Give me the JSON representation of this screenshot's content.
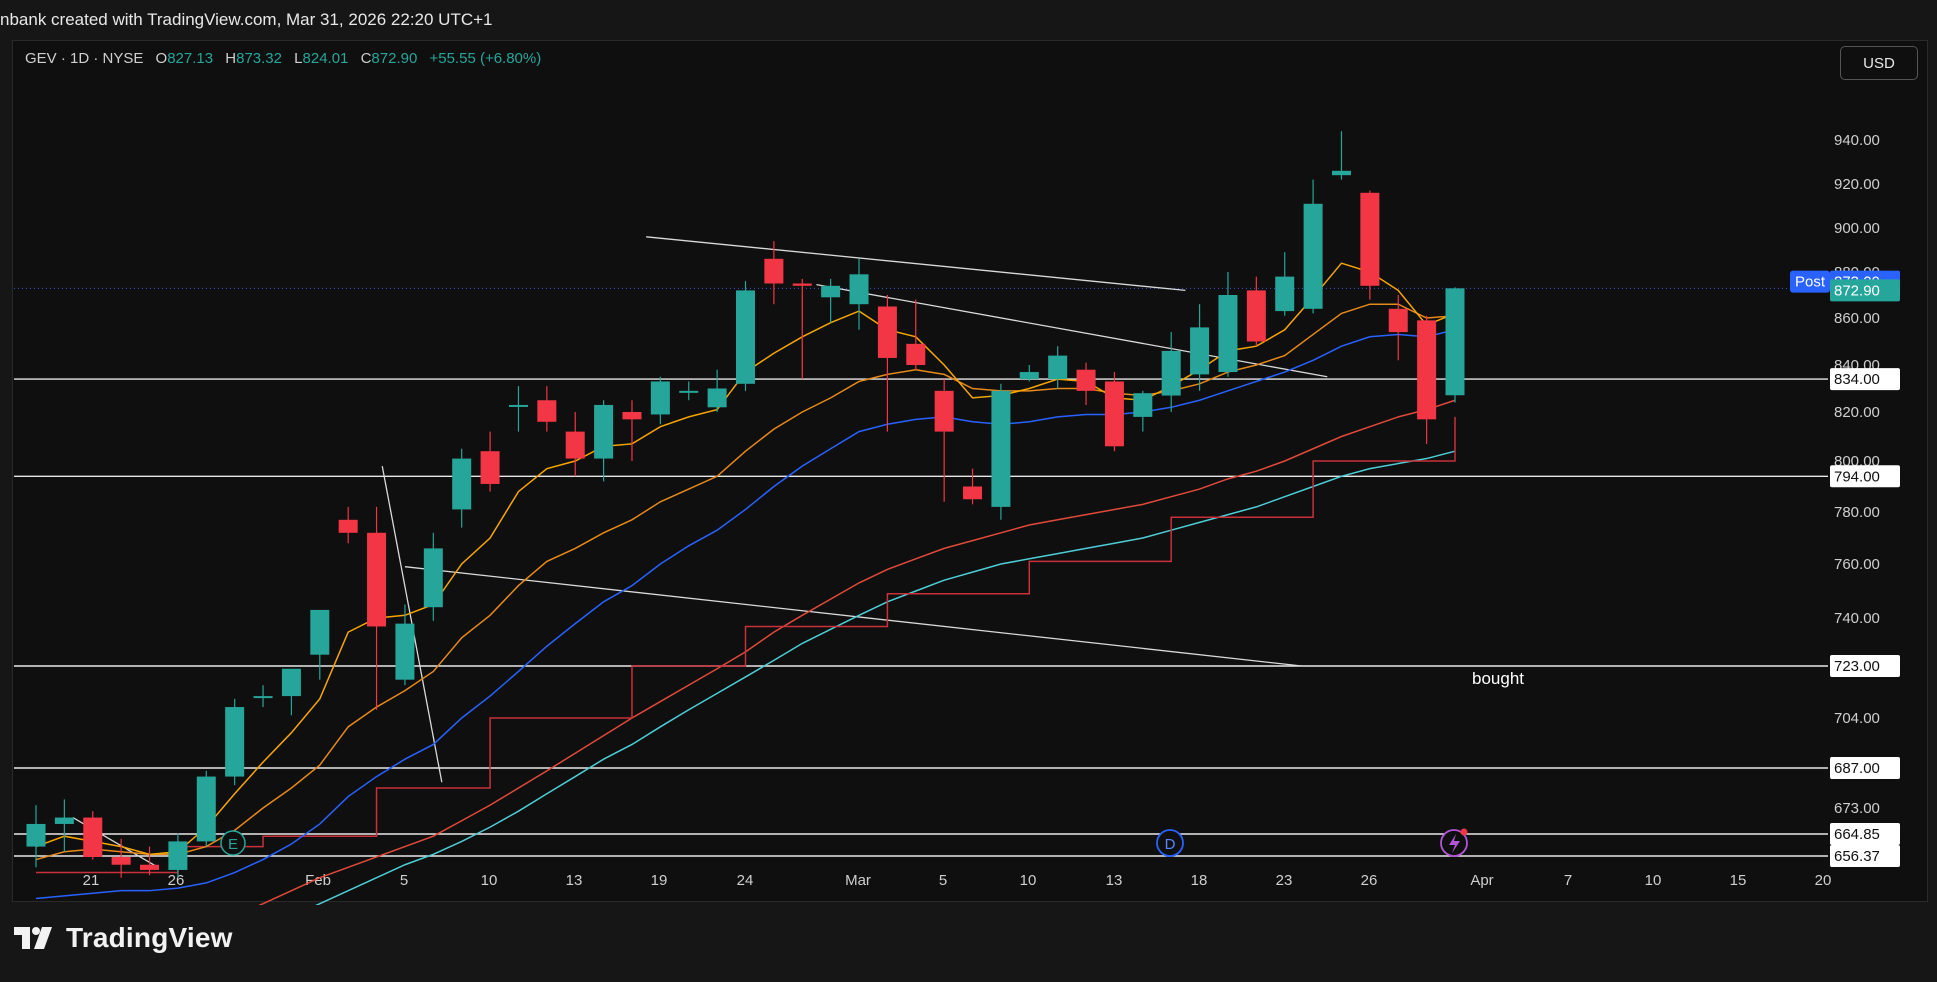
{
  "credit": "nbank created with TradingView.com, Mar 31, 2026 22:20 UTC+1",
  "legend": {
    "symbol": "GEV · 1D · NYSE",
    "o_label": "O",
    "open": "827.13",
    "h_label": "H",
    "high": "873.32",
    "l_label": "L",
    "low": "824.01",
    "c_label": "C",
    "close": "872.90",
    "change": "+55.55 (+6.80%)"
  },
  "currency": "USD",
  "brand": "TradingView",
  "colors": {
    "up": "#26a69a",
    "down": "#f23645",
    "ema_fast": "#f7a600",
    "ema_slow": "#e5891a",
    "sma_blue": "#2962ff",
    "line_red": "#e04a3b",
    "line_teal": "#4ecdd6",
    "kijun_red": "#c8303a",
    "post_badge": "#2962ff"
  },
  "chart_data": {
    "type": "candlestick",
    "y_ticks": [
      "940.00",
      "920.00",
      "900.00",
      "880.00",
      "860.00",
      "840.00",
      "820.00",
      "800.00",
      "780.00",
      "760.00",
      "740.00",
      "723.00",
      "704.00",
      "687.00",
      "673.00",
      "664.85",
      "656.37"
    ],
    "x_ticks": [
      "21",
      "26",
      "Feb",
      "5",
      "10",
      "13",
      "19",
      "24",
      "Mar",
      "5",
      "10",
      "13",
      "18",
      "23",
      "26",
      "Apr",
      "7",
      "10",
      "15",
      "20"
    ],
    "candles": [
      {
        "date": "Jan 16",
        "o": 660,
        "h": 674,
        "l": 652,
        "c": 668
      },
      {
        "date": "Jan 20",
        "o": 668,
        "h": 676,
        "l": 658,
        "c": 670
      },
      {
        "date": "Jan 21",
        "o": 670,
        "h": 672,
        "l": 655,
        "c": 656
      },
      {
        "date": "Jan 22",
        "o": 656,
        "h": 663,
        "l": 648,
        "c": 653
      },
      {
        "date": "Jan 23",
        "o": 653,
        "h": 660,
        "l": 649,
        "c": 651
      },
      {
        "date": "Jan 26",
        "o": 651,
        "h": 665,
        "l": 648,
        "c": 662
      },
      {
        "date": "Jan 27",
        "o": 662,
        "h": 686,
        "l": 660,
        "c": 684
      },
      {
        "date": "Jan 28",
        "o": 684,
        "h": 711,
        "l": 681,
        "c": 708
      },
      {
        "date": "Jan 29",
        "o": 712,
        "h": 716,
        "l": 708,
        "c": 712
      },
      {
        "date": "Jan 30",
        "o": 712,
        "h": 720,
        "l": 705,
        "c": 722
      },
      {
        "date": "Feb 2",
        "o": 727,
        "h": 737,
        "l": 718,
        "c": 743
      },
      {
        "date": "Feb 3",
        "o": 777,
        "h": 782,
        "l": 768,
        "c": 772
      },
      {
        "date": "Feb 4",
        "o": 772,
        "h": 782,
        "l": 707,
        "c": 737
      },
      {
        "date": "Feb 5",
        "o": 718,
        "h": 745,
        "l": 716,
        "c": 738
      },
      {
        "date": "Feb 6",
        "o": 744,
        "h": 772,
        "l": 739,
        "c": 766
      },
      {
        "date": "Feb 9",
        "o": 781,
        "h": 805,
        "l": 774,
        "c": 801
      },
      {
        "date": "Feb 10",
        "o": 804,
        "h": 812,
        "l": 788,
        "c": 791
      },
      {
        "date": "Feb 11",
        "o": 823,
        "h": 831,
        "l": 812,
        "c": 823
      },
      {
        "date": "Feb 12",
        "o": 825,
        "h": 831,
        "l": 812,
        "c": 816
      },
      {
        "date": "Feb 13",
        "o": 812,
        "h": 820,
        "l": 794,
        "c": 801
      },
      {
        "date": "Feb 17",
        "o": 801,
        "h": 825,
        "l": 792,
        "c": 823
      },
      {
        "date": "Feb 18",
        "o": 820,
        "h": 825,
        "l": 800,
        "c": 817
      },
      {
        "date": "Feb 19",
        "o": 819,
        "h": 835,
        "l": 815,
        "c": 833
      },
      {
        "date": "Feb 20",
        "o": 829,
        "h": 833,
        "l": 825,
        "c": 829
      },
      {
        "date": "Feb 23",
        "o": 822,
        "h": 838,
        "l": 820,
        "c": 830
      },
      {
        "date": "Feb 24",
        "o": 832,
        "h": 876,
        "l": 829,
        "c": 872
      },
      {
        "date": "Feb 25",
        "o": 886,
        "h": 894,
        "l": 866,
        "c": 875
      },
      {
        "date": "Feb 26",
        "o": 875,
        "h": 877,
        "l": 834,
        "c": 874
      },
      {
        "date": "Feb 27",
        "o": 869,
        "h": 877,
        "l": 858,
        "c": 874
      },
      {
        "date": "Mar 2",
        "o": 866,
        "h": 886,
        "l": 855,
        "c": 879
      },
      {
        "date": "Mar 3",
        "o": 865,
        "h": 870,
        "l": 812,
        "c": 843
      },
      {
        "date": "Mar 4",
        "o": 849,
        "h": 868,
        "l": 838,
        "c": 840
      },
      {
        "date": "Mar 5",
        "o": 829,
        "h": 834,
        "l": 784,
        "c": 812
      },
      {
        "date": "Mar 6",
        "o": 790,
        "h": 797,
        "l": 783,
        "c": 785
      },
      {
        "date": "Mar 9",
        "o": 782,
        "h": 832,
        "l": 777,
        "c": 829
      },
      {
        "date": "Mar 10",
        "o": 834,
        "h": 840,
        "l": 833,
        "c": 837
      },
      {
        "date": "Mar 11",
        "o": 834,
        "h": 848,
        "l": 830,
        "c": 844
      },
      {
        "date": "Mar 12",
        "o": 838,
        "h": 841,
        "l": 823,
        "c": 829
      },
      {
        "date": "Mar 13",
        "o": 833,
        "h": 837,
        "l": 804,
        "c": 806
      },
      {
        "date": "Mar 16",
        "o": 818,
        "h": 829,
        "l": 812,
        "c": 828
      },
      {
        "date": "Mar 17",
        "o": 827,
        "h": 854,
        "l": 820,
        "c": 846
      },
      {
        "date": "Mar 18",
        "o": 836,
        "h": 866,
        "l": 829,
        "c": 856
      },
      {
        "date": "Mar 19",
        "o": 837,
        "h": 880,
        "l": 835,
        "c": 870
      },
      {
        "date": "Mar 20",
        "o": 872,
        "h": 878,
        "l": 848,
        "c": 850
      },
      {
        "date": "Mar 23",
        "o": 863,
        "h": 889,
        "l": 861,
        "c": 878
      },
      {
        "date": "Mar 24",
        "o": 864,
        "h": 922,
        "l": 862,
        "c": 911
      },
      {
        "date": "Mar 25",
        "o": 924,
        "h": 944,
        "l": 922,
        "c": 926
      },
      {
        "date": "Mar 26",
        "o": 916,
        "h": 917,
        "l": 868,
        "c": 874
      },
      {
        "date": "Mar 27",
        "o": 864,
        "h": 870,
        "l": 842,
        "c": 854
      },
      {
        "date": "Mar 30",
        "o": 859,
        "h": 861,
        "l": 807,
        "c": 817
      },
      {
        "date": "Mar 31",
        "o": 827.13,
        "h": 873.32,
        "l": 824.01,
        "c": 872.9
      }
    ],
    "ema_fast": [
      660,
      664,
      662,
      660,
      657,
      658,
      667,
      678,
      689,
      699,
      711,
      735,
      740,
      741,
      745,
      760,
      770,
      788,
      797,
      800,
      806,
      807,
      814,
      818,
      821,
      837,
      845,
      852,
      858,
      863,
      855,
      852,
      840,
      826,
      827,
      830,
      834,
      833,
      826,
      825,
      831,
      838,
      846,
      848,
      855,
      869,
      884,
      880,
      872,
      857,
      862
    ],
    "ema_slow": [
      655,
      658,
      659,
      658,
      657,
      657,
      660,
      666,
      673,
      680,
      688,
      701,
      708,
      714,
      721,
      733,
      741,
      752,
      761,
      766,
      772,
      777,
      784,
      789,
      794,
      804,
      813,
      820,
      826,
      833,
      836,
      838,
      836,
      830,
      829,
      829,
      830,
      830,
      828,
      827,
      829,
      832,
      837,
      840,
      844,
      853,
      862,
      866,
      866,
      860,
      861
    ],
    "sma_blue": [
      640,
      641,
      642,
      643,
      643,
      644,
      646,
      650,
      655,
      661,
      668,
      677,
      684,
      690,
      695,
      704,
      712,
      721,
      730,
      738,
      746,
      752,
      760,
      767,
      773,
      781,
      790,
      798,
      805,
      812,
      815,
      817,
      818,
      816,
      815,
      816,
      818,
      819,
      819,
      820,
      822,
      825,
      829,
      833,
      837,
      842,
      848,
      852,
      853,
      852,
      855
    ],
    "line_red": [
      610,
      613,
      616,
      619,
      622,
      625,
      629,
      633,
      638,
      643,
      648,
      652,
      656,
      660,
      664,
      669,
      674,
      680,
      686,
      692,
      698,
      704,
      710,
      716,
      722,
      728,
      735,
      741,
      747,
      753,
      758,
      762,
      766,
      769,
      772,
      775,
      777,
      779,
      781,
      783,
      786,
      789,
      793,
      796,
      800,
      805,
      810,
      814,
      818,
      821,
      825
    ],
    "line_teal": [
      600,
      603,
      606,
      609,
      612,
      615,
      619,
      623,
      628,
      633,
      638,
      643,
      648,
      653,
      657,
      662,
      667,
      672,
      678,
      684,
      690,
      695,
      701,
      707,
      713,
      719,
      725,
      731,
      736,
      741,
      746,
      750,
      754,
      757,
      760,
      762,
      764,
      766,
      768,
      770,
      773,
      776,
      779,
      782,
      786,
      790,
      794,
      797,
      799,
      801,
      804
    ],
    "kijun_red": [
      650,
      650,
      650,
      650,
      650,
      660,
      660,
      660,
      664,
      664,
      664,
      664,
      680,
      680,
      680,
      680,
      704,
      704,
      704,
      704,
      704,
      723,
      723,
      723,
      723,
      737,
      737,
      737,
      737,
      737,
      749,
      749,
      749,
      749,
      749,
      761,
      761,
      761,
      761,
      761,
      778,
      778,
      778,
      778,
      778,
      800,
      800,
      800,
      800,
      800,
      818
    ],
    "horizontal_levels": [
      {
        "value": 834.0,
        "label": "834.00"
      },
      {
        "value": 794.0,
        "label": "794.00"
      },
      {
        "value": 723.0,
        "label": "723.00"
      },
      {
        "value": 687.0,
        "label": "687.00"
      },
      {
        "value": 664.85,
        "label": "664.85"
      },
      {
        "value": 656.37,
        "label": "656.37"
      }
    ],
    "price_badges": [
      {
        "label": "Post",
        "value": "873.20"
      },
      {
        "label": "",
        "value": "872.90"
      }
    ],
    "annotations": [
      {
        "text": "bought"
      },
      {
        "text": "E"
      },
      {
        "text": "D"
      }
    ]
  }
}
